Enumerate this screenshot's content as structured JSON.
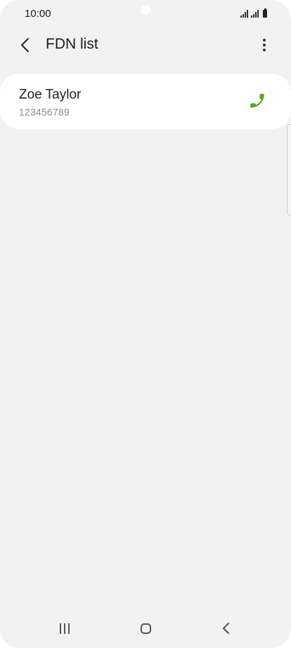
{
  "status_bar": {
    "time": "10:00"
  },
  "header": {
    "title": "FDN list",
    "back_icon": "chevron-left-icon",
    "more_icon": "more-vertical-icon"
  },
  "contacts": [
    {
      "name": "Zoe Taylor",
      "number": "123456789",
      "call_icon": "phone-icon"
    }
  ],
  "nav_bar": {
    "recents_icon": "recents-icon",
    "home_icon": "home-icon",
    "back_icon": "back-icon"
  },
  "colors": {
    "background": "#f2f2f2",
    "card": "#ffffff",
    "call_green": "#5aa323",
    "text_primary": "#1f1f1f",
    "text_secondary": "#8a8a8a"
  }
}
